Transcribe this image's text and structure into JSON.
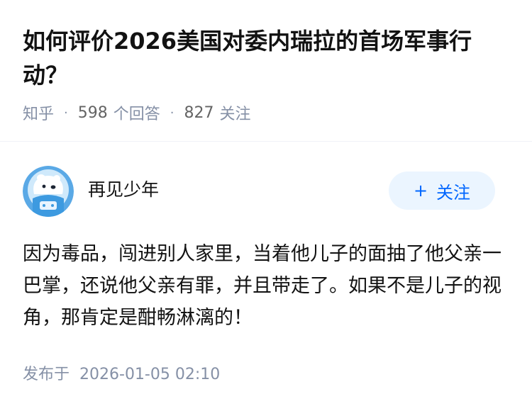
{
  "question": {
    "title": "如何评价2026美国对委内瑞拉的首场军事行动？",
    "source": "知乎",
    "answers_count": "598",
    "answers_label": "个回答",
    "followers_count": "827",
    "followers_label": "关注"
  },
  "answer": {
    "author_name": "再见少年",
    "avatar_icon": "polar-bear-astronaut-icon",
    "follow_label": "关注",
    "follow_icon": "plus-icon",
    "content": "因为毒品，闯进别人家里，当着他儿子的面抽了他父亲一巴掌，还说他父亲有罪，并且带走了。如果不是儿子的视角，那肯定是酣畅淋漓的！",
    "publish_label": "发布于",
    "publish_time": "2026-01-05 02:10"
  },
  "colors": {
    "accent": "#0066ff",
    "accent_bg": "#ebf5ff",
    "meta_text": "#8590a6",
    "title_text": "#121212"
  }
}
